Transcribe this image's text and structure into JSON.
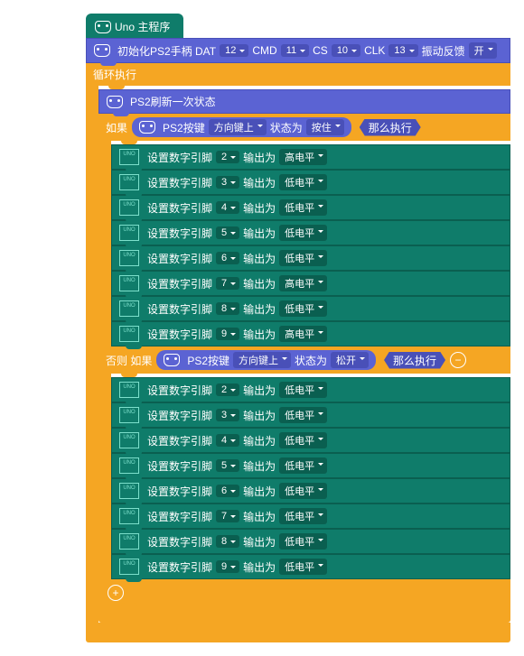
{
  "hat": "Uno 主程序",
  "init": {
    "l": "初始化PS2手柄 DAT",
    "dat": "12",
    "c": "CMD",
    "cmd": "11",
    "s": "CS",
    "cs": "10",
    "k": "CLK",
    "clk": "13",
    "v": "振动反馈",
    "vib": "开"
  },
  "loop": "循环执行",
  "refresh": "PS2刷新一次状态",
  "if": "如果",
  "else": "否则 如果",
  "then": "那么执行",
  "ps2": {
    "l": "PS2按键",
    "key": "方向键上",
    "s": "状态为",
    "press": "按住",
    "rel": "松开"
  },
  "pin": {
    "l": "设置数字引脚",
    "o": "输出为",
    "hi": "高电平",
    "lo": "低电平"
  },
  "plus": "+",
  "minus": "−",
  "b1": [
    {
      "p": "2",
      "v": "hi"
    },
    {
      "p": "3",
      "v": "lo"
    },
    {
      "p": "4",
      "v": "lo"
    },
    {
      "p": "5",
      "v": "lo"
    },
    {
      "p": "6",
      "v": "lo"
    },
    {
      "p": "7",
      "v": "hi"
    },
    {
      "p": "8",
      "v": "lo"
    },
    {
      "p": "9",
      "v": "hi"
    }
  ],
  "b2": [
    {
      "p": "2",
      "v": "lo"
    },
    {
      "p": "3",
      "v": "lo"
    },
    {
      "p": "4",
      "v": "lo"
    },
    {
      "p": "5",
      "v": "lo"
    },
    {
      "p": "6",
      "v": "lo"
    },
    {
      "p": "7",
      "v": "lo"
    },
    {
      "p": "8",
      "v": "lo"
    },
    {
      "p": "9",
      "v": "lo"
    }
  ]
}
